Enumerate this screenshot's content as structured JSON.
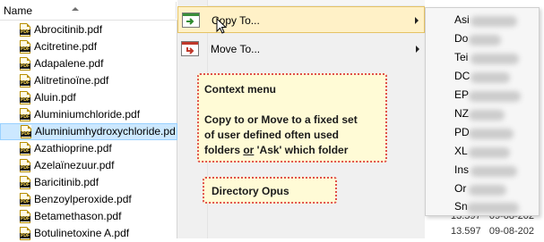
{
  "file_list": {
    "column_header": "Name",
    "files": [
      "Abrocitinib.pdf",
      "Acitretine.pdf",
      "Adapalene.pdf",
      "Alitretinoïne.pdf",
      "Aluin.pdf",
      "Aluminiumchloride.pdf",
      "Aluminiumhydroxychloride.pd",
      "Azathioprine.pdf",
      "Azelaïnezuur.pdf",
      "Baricitinib.pdf",
      "Benzoylperoxide.pdf",
      "Betamethason.pdf",
      "Botulinetoxine A.pdf"
    ],
    "selected_index": 6
  },
  "context_menu": {
    "copy_to": "Copy To...",
    "move_to": "Move To..."
  },
  "callouts": {
    "main_title": "Context menu",
    "main_line1": "Copy to or Move to a fixed set",
    "main_line2": "of user defined often used",
    "main_line3_prefix": "folders ",
    "main_line3_or": "or",
    "main_line3_suffix": " 'Ask' which folder",
    "opus": "Directory Opus"
  },
  "submenu": {
    "items": [
      "Asi",
      "Do",
      "Tei",
      "DC",
      "EP",
      "NZ",
      "PD",
      "XL",
      "Ins",
      "Or",
      "Sn"
    ]
  },
  "details": {
    "rows": [
      {
        "size": "13.597",
        "date": "09-08-202"
      },
      {
        "size": "13.597",
        "date": "09-08-202"
      }
    ]
  },
  "colors": {
    "selection": "#cce8ff",
    "menu_highlight": "#fff1c7",
    "callout_bg": "#fffbd6",
    "callout_border": "#e0504a"
  }
}
